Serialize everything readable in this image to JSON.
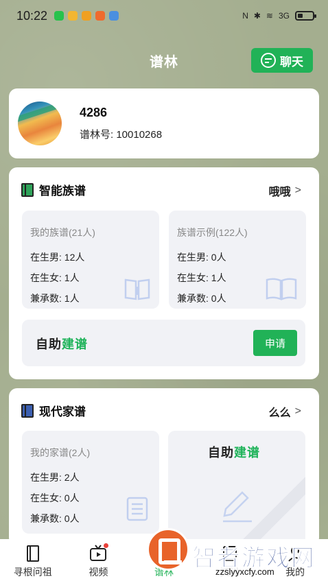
{
  "status_bar": {
    "time": "10:22",
    "signal_label": "3G",
    "battery_level": 0.35
  },
  "header": {
    "title": "谱林",
    "chat_label": "聊天"
  },
  "profile": {
    "name": "4286",
    "id_label": "谱林号: 10010268"
  },
  "genealogy": {
    "title": "智能族谱",
    "more_label": "哦哦",
    "my": {
      "title": "我的族谱(21人)",
      "male": "在生男: 12人",
      "female": "在生女: 1人",
      "heirs": "兼承数: 1人"
    },
    "example": {
      "title": "族谱示例(122人)",
      "male": "在生男: 0人",
      "female": "在生女: 1人",
      "heirs": "兼承数: 0人"
    },
    "self_build_dark": "自助",
    "self_build_green": "建谱",
    "apply_label": "申请"
  },
  "family": {
    "title": "现代家谱",
    "more_label": "么么",
    "my": {
      "title": "我的家谱(2人)",
      "male": "在生男: 2人",
      "female": "在生女: 0人",
      "heirs": "兼承数: 0人"
    },
    "self_build_dark": "自助",
    "self_build_green": "建谱"
  },
  "nav": {
    "items": [
      {
        "label": "寻根问祖",
        "icon": "book-icon"
      },
      {
        "label": "视频",
        "icon": "video-icon"
      },
      {
        "label": "谱林",
        "icon": "forest-icon"
      },
      {
        "label": "资讯",
        "icon": "news-icon"
      },
      {
        "label": "我的",
        "icon": "profile-icon"
      }
    ]
  },
  "watermark": {
    "text": "智者游戏网",
    "url": "zzslyyxcfy.com"
  },
  "colors": {
    "accent": "#21b257",
    "background": "#a4ae8f"
  }
}
